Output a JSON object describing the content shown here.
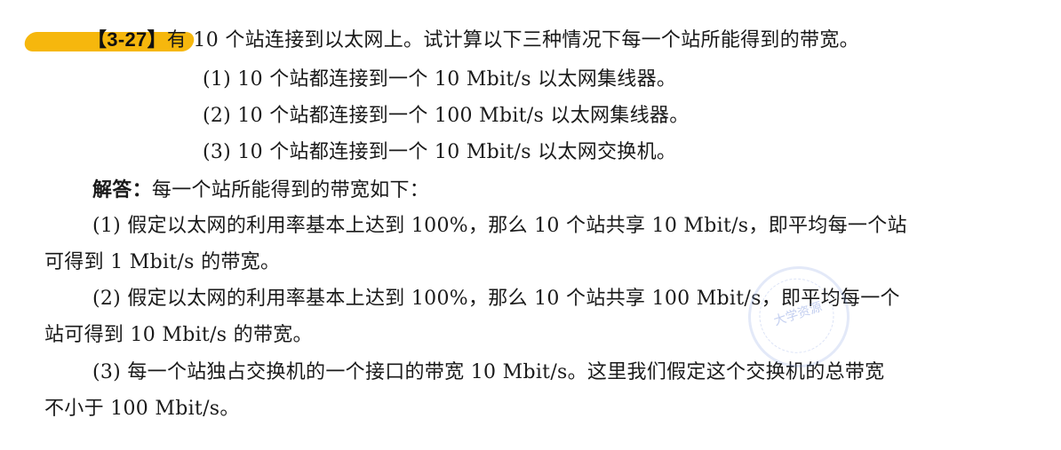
{
  "question": {
    "number": "【3-27】",
    "text": "有 10 个站连接到以太网上。试计算以下三种情况下每一个站所能得到的带宽。",
    "cases": [
      "(1) 10 个站都连接到一个 10 Mbit/s 以太网集线器。",
      "(2) 10 个站都连接到一个 100 Mbit/s 以太网集线器。",
      "(3) 10 个站都连接到一个 10 Mbit/s 以太网交换机。"
    ]
  },
  "answer": {
    "label": "解答：",
    "intro": "每一个站所能得到的带宽如下：",
    "paragraphs": [
      {
        "line1": "(1) 假定以太网的利用率基本上达到 100%，那么 10 个站共享 10 Mbit/s，即平均每一个站",
        "line2": "可得到 1 Mbit/s 的带宽。"
      },
      {
        "line1": "(2) 假定以太网的利用率基本上达到 100%，那么 10 个站共享 100 Mbit/s，即平均每一个",
        "line2": "站可得到 10 Mbit/s 的带宽。"
      },
      {
        "line1": "(3) 每一个站独占交换机的一个接口的带宽 10 Mbit/s。这里我们假定这个交换机的总带宽",
        "line2": "不小于 100 Mbit/s。"
      }
    ]
  },
  "stamp": {
    "text": "大学资源"
  },
  "colors": {
    "highlight": "#f5b300",
    "text": "#1a1a1a",
    "stamp": "#6e8cdc"
  }
}
